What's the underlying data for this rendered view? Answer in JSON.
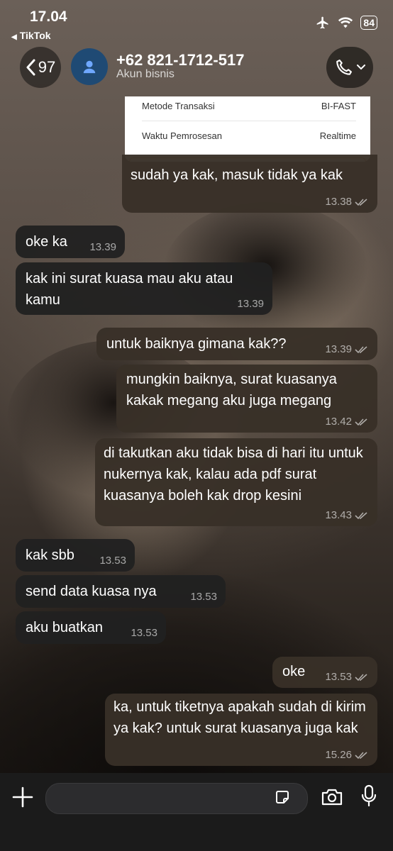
{
  "status": {
    "time": "17.04",
    "back_app": "TikTok",
    "battery": "84"
  },
  "header": {
    "back_count": "97",
    "contact_name": "+62 821-1712-517",
    "contact_sub": "Akun bisnis"
  },
  "receipt": {
    "rows": [
      {
        "label": "Metode Transaksi",
        "value": "BI-FAST"
      },
      {
        "label": "Waktu Pemrosesan",
        "value": "Realtime"
      }
    ]
  },
  "messages": [
    {
      "dir": "out",
      "text": "sudah ya kak, masuk tidak ya kak",
      "time": "13.38",
      "read": true
    },
    {
      "dir": "in",
      "text": "oke ka",
      "time": "13.39"
    },
    {
      "dir": "in",
      "text": "kak ini surat kuasa mau aku atau kamu",
      "time": "13.39"
    },
    {
      "dir": "out",
      "text": "untuk baiknya gimana kak??",
      "time": "13.39",
      "read": true
    },
    {
      "dir": "out",
      "text": "mungkin baiknya, surat kuasanya kakak megang aku juga megang",
      "time": "13.42",
      "read": true
    },
    {
      "dir": "out",
      "text": "di takutkan aku tidak bisa di hari itu untuk nukernya kak, kalau ada pdf surat kuasanya boleh kak drop kesini",
      "time": "13.43",
      "read": true
    },
    {
      "dir": "in",
      "text": "kak sbb",
      "time": "13.53"
    },
    {
      "dir": "in",
      "text": "send data kuasa nya",
      "time": "13.53"
    },
    {
      "dir": "in",
      "text": "aku buatkan",
      "time": "13.53"
    },
    {
      "dir": "out",
      "text": "oke",
      "time": "13.53",
      "read": true
    },
    {
      "dir": "out",
      "text": "ka, untuk tiketnya apakah sudah di kirim ya kak? untuk surat kuasanya juga kak",
      "time": "15.26",
      "read": true
    }
  ],
  "input": {
    "placeholder": ""
  }
}
